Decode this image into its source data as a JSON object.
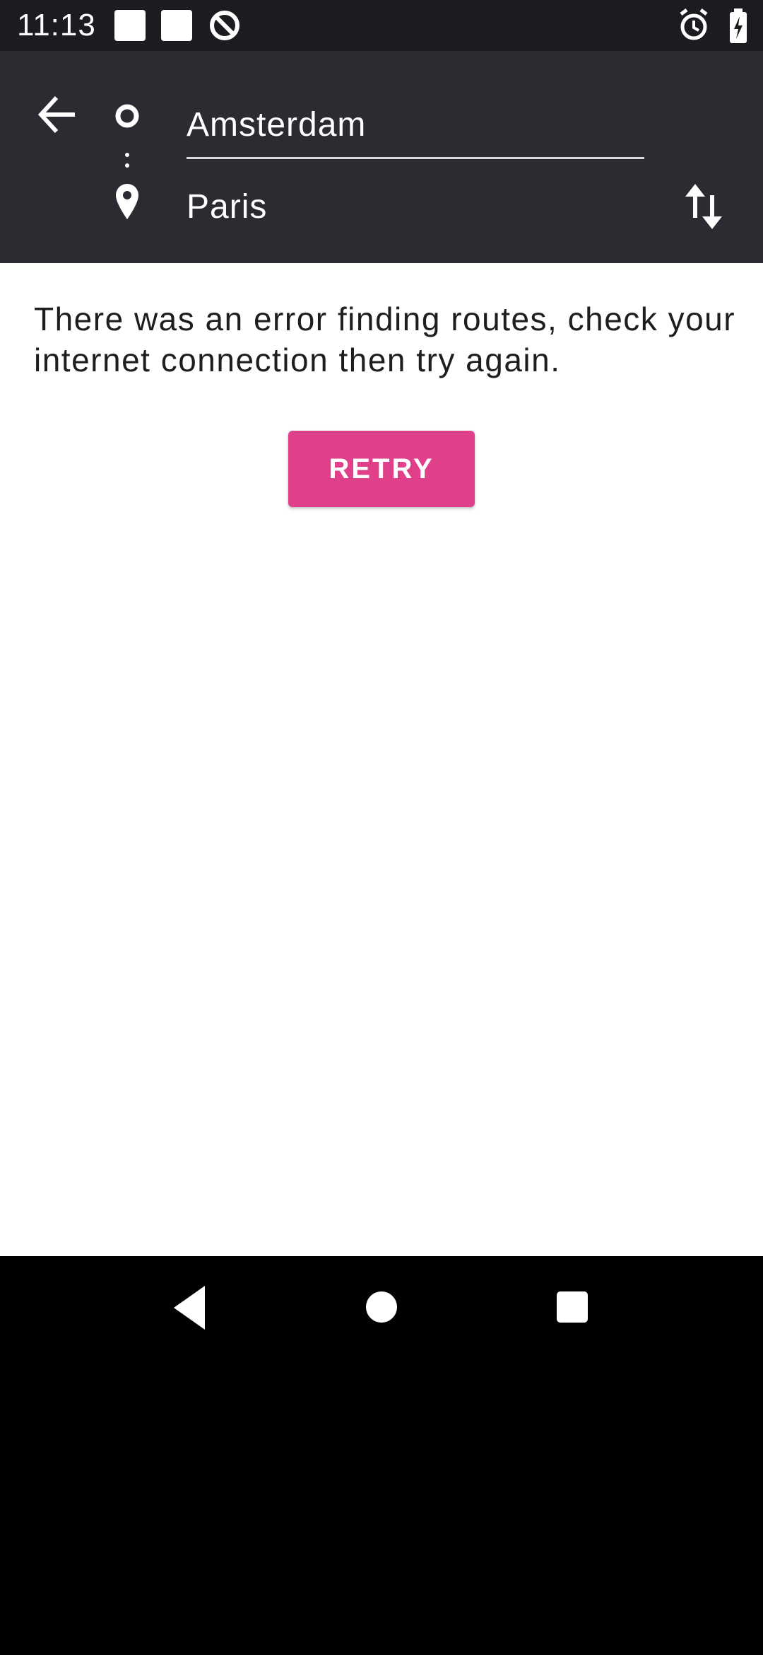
{
  "status_bar": {
    "time": "11:13",
    "icons": [
      "notification-square-icon",
      "notification-square-icon",
      "at-sign-icon",
      "alarm-icon",
      "battery-charging-icon"
    ]
  },
  "toolbar": {
    "from": "Amsterdam",
    "to": "Paris",
    "icons": [
      "back-arrow-icon",
      "origin-dot-icon",
      "location-pin-icon",
      "swap-icon"
    ]
  },
  "content": {
    "error_message": "There was an error finding routes, check your internet connection then try again.",
    "retry_label": "RETRY"
  },
  "colors": {
    "toolbar_bg": "#2d2a31",
    "accent": "#e0408a",
    "status_bar_bg": "#1c1b1f"
  },
  "nav_bar": {
    "icons": [
      "nav-back-icon",
      "nav-home-icon",
      "nav-recents-icon"
    ]
  }
}
